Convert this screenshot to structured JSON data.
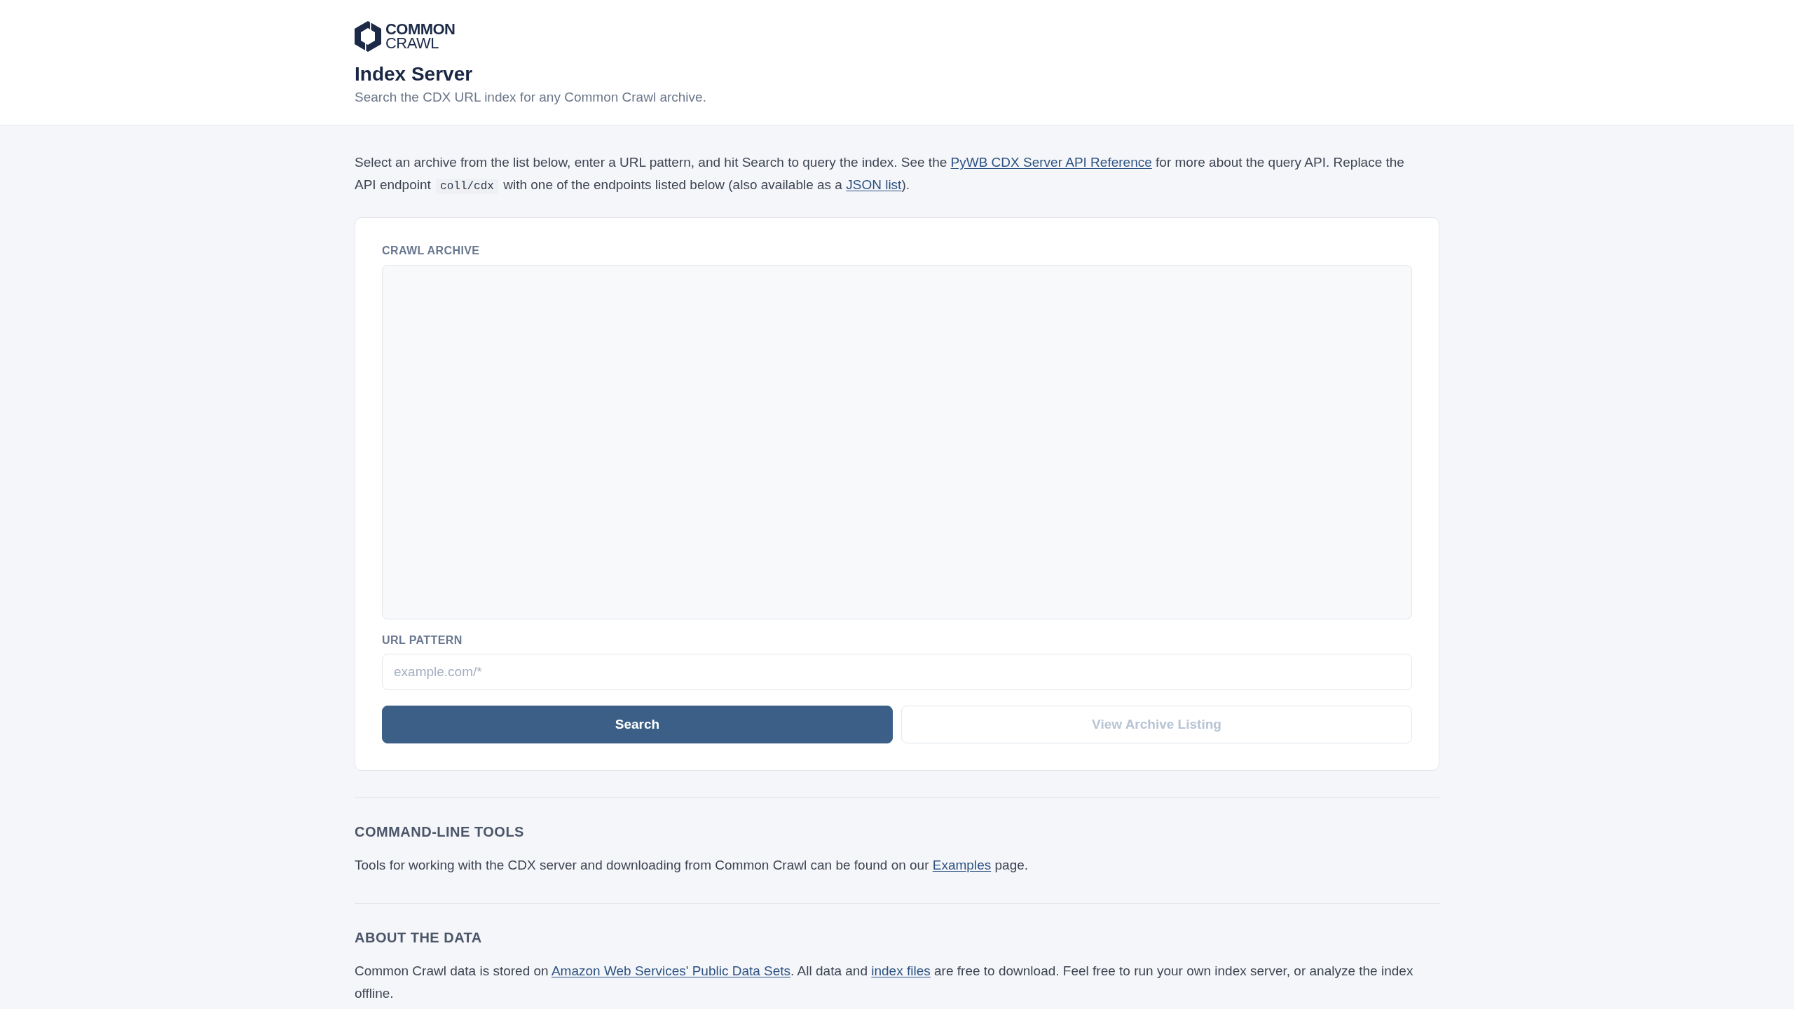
{
  "header": {
    "logo": {
      "line_1": "COMMON",
      "line_2": "CRAWL"
    },
    "title": "Index Server",
    "subtitle": "Search the CDX URL index for any Common Crawl archive."
  },
  "intro": [
    {
      "kind": "text",
      "text": "Select an archive from the list below, enter a URL pattern, and hit Search to query the index. See the "
    },
    {
      "kind": "link",
      "text": "PyWB CDX Server API Reference"
    },
    {
      "kind": "text",
      "text": " for more about the query API. Replace the API endpoint "
    },
    {
      "kind": "code",
      "text": "coll/cdx"
    },
    {
      "kind": "text",
      "text": " with one of the endpoints listed below (also available as a "
    },
    {
      "kind": "link",
      "text": "JSON list"
    },
    {
      "kind": "text",
      "text": ")."
    }
  ],
  "form": {
    "archive_label": "CRAWL ARCHIVE",
    "url_label": "URL PATTERN",
    "url_placeholder": "example.com/*",
    "buttons": [
      {
        "label": "Search",
        "kind": "primary",
        "disabled": false
      },
      {
        "label": "View Archive Listing",
        "kind": "secondary",
        "disabled": true
      }
    ]
  },
  "sections": [
    {
      "title": "COMMAND-LINE TOOLS",
      "body": [
        {
          "kind": "text",
          "text": "Tools for working with the CDX server and downloading from Common Crawl can be found on our "
        },
        {
          "kind": "link",
          "text": "Examples"
        },
        {
          "kind": "text",
          "text": " page."
        }
      ]
    },
    {
      "title": "ABOUT THE DATA",
      "body": [
        {
          "kind": "text",
          "text": "Common Crawl data is stored on "
        },
        {
          "kind": "link",
          "text": "Amazon Web Services' Public Data Sets"
        },
        {
          "kind": "text",
          "text": ". All data and "
        },
        {
          "kind": "link",
          "text": "index files"
        },
        {
          "kind": "text",
          "text": " are free to download. Feel free to run your own index server, or analyze the index offline."
        }
      ]
    }
  ]
}
